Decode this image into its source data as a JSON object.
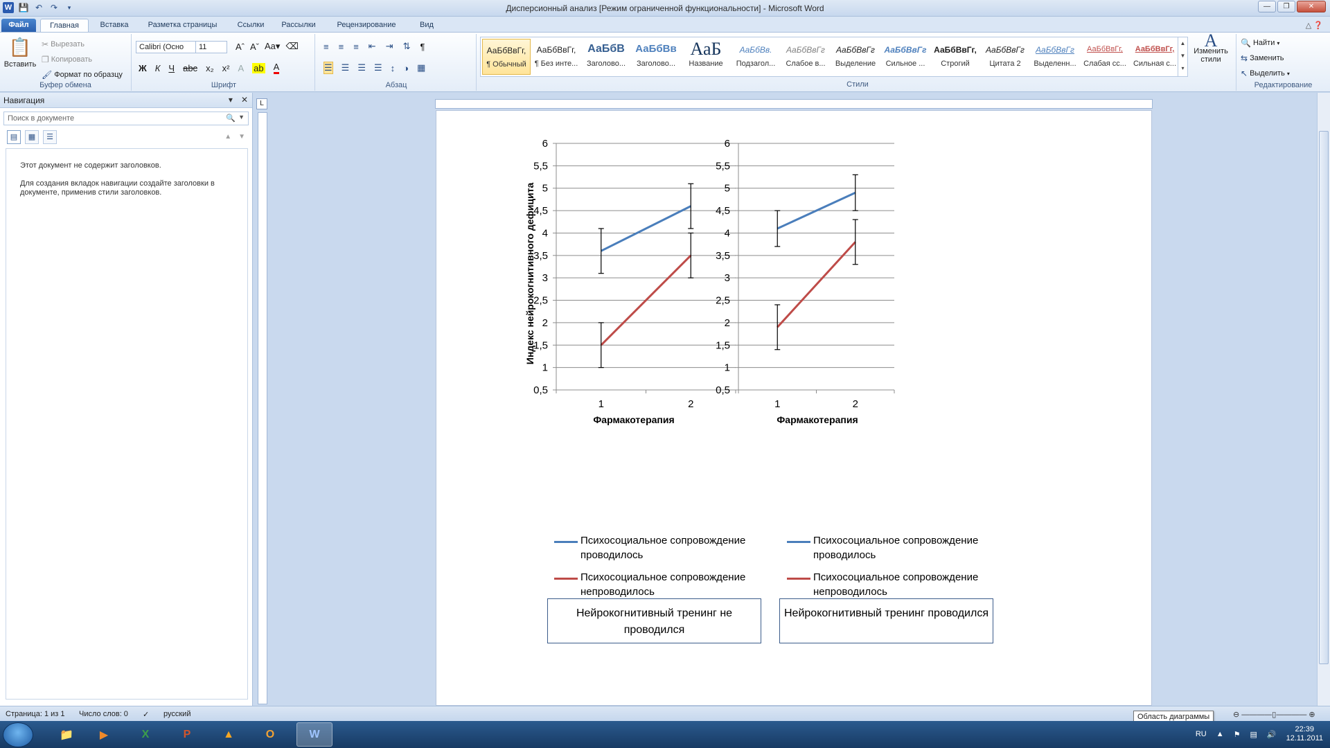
{
  "window": {
    "title": "Дисперсионный анализ [Режим ограниченной функциональности]  -  Microsoft Word"
  },
  "tabs": [
    "Файл",
    "Главная",
    "Вставка",
    "Разметка страницы",
    "Ссылки",
    "Рассылки",
    "Рецензирование",
    "Вид"
  ],
  "ribbon": {
    "clipboard": {
      "paste": "Вставить",
      "cut": "Вырезать",
      "copy": "Копировать",
      "format_painter": "Формат по образцу",
      "label": "Буфер обмена"
    },
    "font": {
      "name": "Calibri (Осно",
      "size": "11",
      "label": "Шрифт"
    },
    "paragraph": {
      "label": "Абзац"
    },
    "styles": {
      "label": "Стили",
      "items": [
        {
          "sample": "АаБбВвГг,",
          "name": "¶ Обычный"
        },
        {
          "sample": "АаБбВвГг,",
          "name": "¶ Без инте..."
        },
        {
          "sample": "АаБбВ",
          "name": "Заголово..."
        },
        {
          "sample": "АаБбВв",
          "name": "Заголово..."
        },
        {
          "sample": "АаБ",
          "name": "Название"
        },
        {
          "sample": "АаБбВв.",
          "name": "Подзагол..."
        },
        {
          "sample": "АаБбВвГг",
          "name": "Слабое в..."
        },
        {
          "sample": "АаБбВвГг",
          "name": "Выделение"
        },
        {
          "sample": "АаБбВвГг",
          "name": "Сильное ..."
        },
        {
          "sample": "АаБбВвГг,",
          "name": "Строгий"
        },
        {
          "sample": "АаБбВвГг",
          "name": "Цитата 2"
        },
        {
          "sample": "АаБбВвГг",
          "name": "Выделенн..."
        },
        {
          "sample": "АаБбВвГг,",
          "name": "Слабая сс..."
        },
        {
          "sample": "АаБбВвГг,",
          "name": "Сильная с..."
        }
      ],
      "change": "Изменить стили"
    },
    "editing": {
      "find": "Найти",
      "replace": "Заменить",
      "select": "Выделить",
      "label": "Редактирование"
    }
  },
  "nav": {
    "title": "Навигация",
    "search_placeholder": "Поиск в документе",
    "msg1": "Этот документ не содержит заголовков.",
    "msg2": "Для создания вкладок навигации создайте заголовки в документе, применив стили заголовков."
  },
  "status": {
    "page": "Страница: 1 из 1",
    "words": "Число слов: 0",
    "lang": "русский",
    "tooltip": "Область диаграммы"
  },
  "tray": {
    "lang": "RU",
    "time": "22:39",
    "date": "12.11.2011"
  },
  "chart_data": [
    {
      "type": "line",
      "x": [
        1,
        2
      ],
      "ylim": [
        0.5,
        6
      ],
      "yticks": [
        "0,5",
        "1",
        "1,5",
        "2",
        "2,5",
        "3",
        "3,5",
        "4",
        "4,5",
        "5",
        "5,5",
        "6"
      ],
      "xlabel": "Фармакотерапия",
      "ylabel": "Индекс нейрокогнитивного  дефицита",
      "series": [
        {
          "name": "Психосоциальное  сопровождение проводилось",
          "color": "#4a7ebb",
          "values": [
            3.6,
            4.6
          ],
          "error": [
            0.5,
            0.5
          ]
        },
        {
          "name": "Психосоциальное  сопровождение непроводилось",
          "color": "#be4b48",
          "values": [
            1.5,
            3.5
          ],
          "error": [
            0.5,
            0.5
          ]
        }
      ],
      "caption": "Нейрокогнитивный тренинг не проводился"
    },
    {
      "type": "line",
      "x": [
        1,
        2
      ],
      "ylim": [
        0.5,
        6
      ],
      "yticks": [
        "0,5",
        "1",
        "1,5",
        "2",
        "2,5",
        "3",
        "3,5",
        "4",
        "4,5",
        "5",
        "5,5",
        "6"
      ],
      "xlabel": "Фармакотерапия",
      "ylabel": "",
      "series": [
        {
          "name": "Психосоциальное  сопровождение проводилось",
          "color": "#4a7ebb",
          "values": [
            4.1,
            4.9
          ],
          "error": [
            0.4,
            0.4
          ]
        },
        {
          "name": "Психосоциальное  сопровождение непроводилось",
          "color": "#be4b48",
          "values": [
            1.9,
            3.8
          ],
          "error": [
            0.5,
            0.5
          ]
        }
      ],
      "caption": "Нейрокогнитивный  тренинг проводился"
    }
  ]
}
